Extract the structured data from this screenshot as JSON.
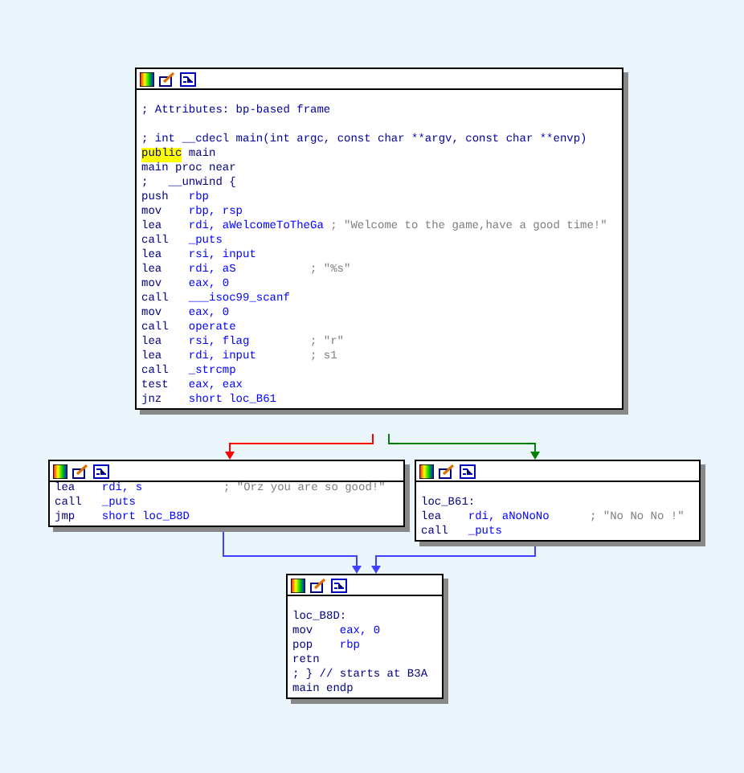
{
  "blocks": [
    {
      "lines": [
        {
          "kind": "blank"
        },
        {
          "kind": "comment",
          "text": "; Attributes: bp-based frame"
        },
        {
          "kind": "blank"
        },
        {
          "kind": "comment",
          "text": "; int __cdecl main(int argc, const char **argv, const char **envp)"
        },
        {
          "kind": "public",
          "keyword": "public",
          "name": "main",
          "highlighted": true
        },
        {
          "kind": "directive",
          "text": "main proc near"
        },
        {
          "kind": "directive",
          "text": ";   __unwind {"
        },
        {
          "kind": "insn",
          "mnemonic": "push",
          "operands": "rbp"
        },
        {
          "kind": "insn",
          "mnemonic": "mov",
          "operands": "rbp, rsp"
        },
        {
          "kind": "insn",
          "mnemonic": "lea",
          "operands": "rdi, aWelcomeToTheGa",
          "comment": "; \"Welcome to the game,have a good time!\""
        },
        {
          "kind": "insn",
          "mnemonic": "call",
          "operands": "_puts"
        },
        {
          "kind": "insn",
          "mnemonic": "lea",
          "operands": "rsi, input"
        },
        {
          "kind": "insn",
          "mnemonic": "lea",
          "operands": "rdi, aS",
          "comment": "; \"%s\""
        },
        {
          "kind": "insn",
          "mnemonic": "mov",
          "operands": "eax, 0"
        },
        {
          "kind": "insn",
          "mnemonic": "call",
          "operands": "___isoc99_scanf"
        },
        {
          "kind": "insn",
          "mnemonic": "mov",
          "operands": "eax, 0"
        },
        {
          "kind": "insn",
          "mnemonic": "call",
          "operands": "operate"
        },
        {
          "kind": "insn",
          "mnemonic": "lea",
          "operands": "rsi, flag",
          "comment": "; \"r\""
        },
        {
          "kind": "insn",
          "mnemonic": "lea",
          "operands": "rdi, input",
          "comment": "; s1"
        },
        {
          "kind": "insn",
          "mnemonic": "call",
          "operands": "_strcmp"
        },
        {
          "kind": "insn",
          "mnemonic": "test",
          "operands": "eax, eax"
        },
        {
          "kind": "insn",
          "mnemonic": "jnz",
          "operands": "short loc_B61"
        }
      ]
    },
    {
      "lines": [
        {
          "kind": "insn",
          "mnemonic": "lea",
          "operands": "rdi, s",
          "comment": "; \"Orz you are so good!\""
        },
        {
          "kind": "insn",
          "mnemonic": "call",
          "operands": "_puts"
        },
        {
          "kind": "insn",
          "mnemonic": "jmp",
          "operands": "short loc_B8D"
        }
      ]
    },
    {
      "lines": [
        {
          "kind": "blank"
        },
        {
          "kind": "label",
          "text": "loc_B61:"
        },
        {
          "kind": "insn",
          "mnemonic": "lea",
          "operands": "rdi, aNoNoNo",
          "comment": "; \"No No No !\""
        },
        {
          "kind": "insn",
          "mnemonic": "call",
          "operands": "_puts"
        }
      ]
    },
    {
      "lines": [
        {
          "kind": "blank"
        },
        {
          "kind": "label",
          "text": "loc_B8D:"
        },
        {
          "kind": "insn",
          "mnemonic": "mov",
          "operands": "eax, 0"
        },
        {
          "kind": "insn",
          "mnemonic": "pop",
          "operands": "rbp"
        },
        {
          "kind": "insn",
          "mnemonic": "retn"
        },
        {
          "kind": "directive",
          "text": "; } // starts at B3A"
        },
        {
          "kind": "directive",
          "text": "main endp"
        }
      ]
    }
  ],
  "edges": [
    {
      "color": "#ff0000"
    },
    {
      "color": "#008000"
    },
    {
      "color": "#4040ff"
    },
    {
      "color": "#4040ff"
    }
  ]
}
